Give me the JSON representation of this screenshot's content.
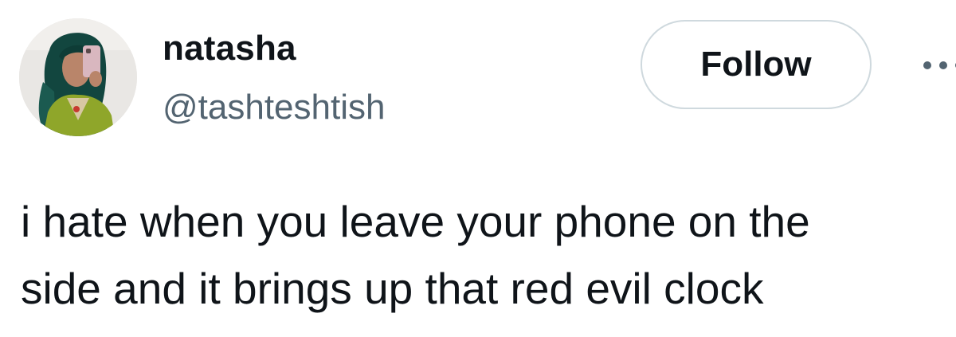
{
  "author": {
    "display_name": "natasha",
    "handle": "@tashteshtish",
    "avatar_icon": "profile-photo"
  },
  "actions": {
    "follow_label": "Follow",
    "more_icon": "more-options-icon"
  },
  "tweet": {
    "text": "i hate when you leave your phone on the\nside and it brings up that red evil clock"
  },
  "colors": {
    "text_primary": "#0f1419",
    "text_secondary": "#536471",
    "button_border": "#cfd9de",
    "background": "#ffffff"
  }
}
